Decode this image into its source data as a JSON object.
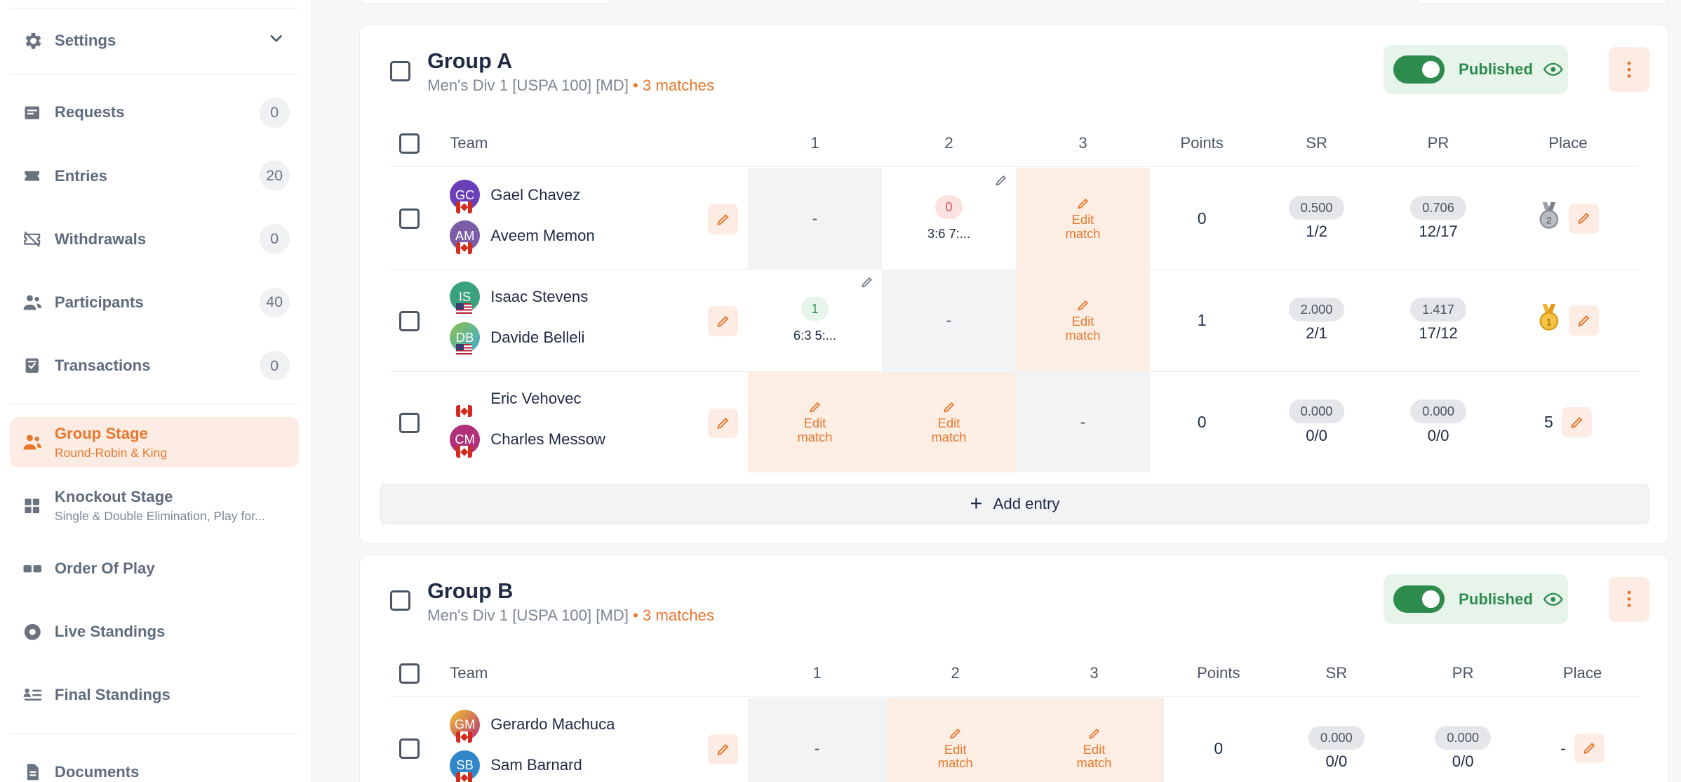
{
  "sidebar": {
    "settings": {
      "label": "Settings",
      "icon": "gear-icon"
    },
    "items": [
      {
        "key": "requests",
        "label": "Requests",
        "count": "0",
        "icon": "requests-icon"
      },
      {
        "key": "entries",
        "label": "Entries",
        "count": "20",
        "icon": "ticket-icon"
      },
      {
        "key": "withdrawals",
        "label": "Withdrawals",
        "count": "0",
        "icon": "withdraw-icon"
      },
      {
        "key": "participants",
        "label": "Participants",
        "count": "40",
        "icon": "people-icon"
      },
      {
        "key": "transactions",
        "label": "Transactions",
        "count": "0",
        "icon": "receipt-icon"
      }
    ],
    "stages": [
      {
        "key": "group-stage",
        "label": "Group Stage",
        "sub": "Round-Robin & King",
        "active": true
      },
      {
        "key": "knockout-stage",
        "label": "Knockout Stage",
        "sub": "Single & Double Elimination, Play for..."
      },
      {
        "key": "order-of-play",
        "label": "Order Of Play"
      },
      {
        "key": "live-standings",
        "label": "Live Standings"
      },
      {
        "key": "final-standings",
        "label": "Final Standings"
      },
      {
        "key": "documents",
        "label": "Documents"
      }
    ]
  },
  "groups": [
    {
      "title": "Group A",
      "division": "Men's Div 1 [USPA 100] [MD]",
      "dot": "•",
      "matches": "3 matches",
      "published_label": "Published",
      "headers": {
        "team": "Team",
        "c1": "1",
        "c2": "2",
        "c3": "3",
        "points": "Points",
        "sr": "SR",
        "pr": "PR",
        "place": "Place"
      },
      "rows": [
        {
          "players": [
            {
              "name": "Gael Chavez",
              "initials": "GC",
              "color": "#6b3fb8",
              "flag": "ca"
            },
            {
              "name": "Aveem Memon",
              "initials": "AM",
              "color": "#7b5ea7",
              "flag": "ca"
            }
          ],
          "cells": [
            {
              "type": "dash",
              "text": "-"
            },
            {
              "type": "result",
              "badge": "0",
              "badge_kind": "loss",
              "score": "3:6 7:..."
            },
            {
              "type": "edit",
              "text1": "Edit",
              "text2": "match"
            }
          ],
          "points": "0",
          "sr_pill": "0.500",
          "sr": "1/2",
          "pr_pill": "0.706",
          "pr": "12/17",
          "place": {
            "kind": "medal",
            "medal": "silver-medal-icon"
          }
        },
        {
          "players": [
            {
              "name": "Isaac Stevens",
              "initials": "IS",
              "color": "#3aa17e",
              "flag": "us"
            },
            {
              "name": "Davide Belleli",
              "initials": "DB",
              "color": "#8bc34a",
              "flag": "us"
            }
          ],
          "cells": [
            {
              "type": "result",
              "badge": "1",
              "badge_kind": "win",
              "score": "6:3 5:..."
            },
            {
              "type": "dash",
              "text": "-"
            },
            {
              "type": "edit",
              "text1": "Edit",
              "text2": "match"
            }
          ],
          "points": "1",
          "sr_pill": "2.000",
          "sr": "2/1",
          "pr_pill": "1.417",
          "pr": "17/12",
          "place": {
            "kind": "medal",
            "medal": "gold-medal-icon"
          }
        },
        {
          "players": [
            {
              "name": "Eric Vehovec",
              "initials": "",
              "color": "",
              "flag": "ca"
            },
            {
              "name": "Charles Messow",
              "initials": "CM",
              "color": "#b0307a",
              "flag": "ca"
            }
          ],
          "cells": [
            {
              "type": "edit",
              "text1": "Edit",
              "text2": "match"
            },
            {
              "type": "edit",
              "text1": "Edit",
              "text2": "match"
            },
            {
              "type": "dash",
              "text": "-"
            }
          ],
          "points": "0",
          "sr_pill": "0.000",
          "sr": "0/0",
          "pr_pill": "0.000",
          "pr": "0/0",
          "place": {
            "kind": "number",
            "value": "5"
          }
        }
      ],
      "add_entry": "Add entry"
    },
    {
      "title": "Group B",
      "division": "Men's Div 1 [USPA 100] [MD]",
      "dot": "•",
      "matches": "3 matches",
      "published_label": "Published",
      "headers": {
        "team": "Team",
        "c1": "1",
        "c2": "2",
        "c3": "3",
        "points": "Points",
        "sr": "SR",
        "pr": "PR",
        "place": "Place"
      },
      "rows": [
        {
          "players": [
            {
              "name": "Gerardo Machuca",
              "initials": "GM",
              "color": "#d4a017",
              "flag": "ca"
            },
            {
              "name": "Sam Barnard",
              "initials": "SB",
              "color": "#2f86c9",
              "flag": "ca"
            }
          ],
          "cells": [
            {
              "type": "dash",
              "text": "-"
            },
            {
              "type": "edit",
              "text1": "Edit",
              "text2": "match"
            },
            {
              "type": "edit",
              "text1": "Edit",
              "text2": "match"
            }
          ],
          "points": "0",
          "sr_pill": "0.000",
          "sr": "0/0",
          "pr_pill": "0.000",
          "pr": "0/0",
          "place": {
            "kind": "number",
            "value": "-"
          }
        }
      ]
    }
  ],
  "colors": {
    "accent": "#e8772e",
    "published": "#2e8b4e"
  }
}
